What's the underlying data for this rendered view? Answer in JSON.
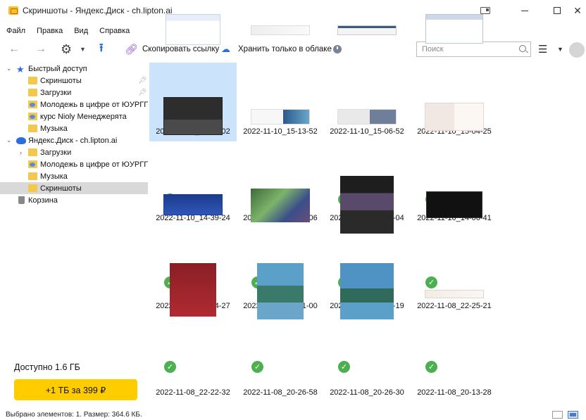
{
  "window": {
    "title": "Скриншоты - Яндекс.Диск - ch.lipton.ai"
  },
  "menu": [
    "Файл",
    "Правка",
    "Вид",
    "Справка"
  ],
  "toolbar": {
    "back_icon": "arrow-left-icon",
    "forward_icon": "arrow-right-icon",
    "copy_link_label": "Скопировать ссылку",
    "cloud_only_label": "Хранить только в облаке"
  },
  "search": {
    "placeholder": "Поиск",
    "value": ""
  },
  "sidebar": {
    "quick_access": {
      "label": "Быстрый доступ",
      "items": [
        "Скриншоты",
        "Загрузки",
        "Молодежь в цифре от ЮУРГГПУ",
        "курс Nioly Менеджерята",
        "Музыка"
      ]
    },
    "disk": {
      "label": "Яндекс.Диск - ch.lipton.ai",
      "items": [
        "Загрузки",
        "Молодежь в цифре от ЮУРГГПУ",
        "Музыка",
        "Скриншоты"
      ],
      "selected": "Скриншоты"
    },
    "trash_label": "Корзина",
    "storage_text": "Доступно 1.6 ГБ",
    "buy_button": "+1 ТБ за 399 ₽"
  },
  "files": [
    {
      "name": "2022-11-10_15-04-02",
      "selected": true
    },
    {
      "name": "2022-11-10_15-13-52",
      "selected": false
    },
    {
      "name": "2022-11-10_15-06-52",
      "selected": false
    },
    {
      "name": "2022-11-10_15-04-25",
      "selected": false
    },
    {
      "name": "2022-11-10_14-39-24",
      "selected": false
    },
    {
      "name": "2022-11-10_14-09-06",
      "selected": false
    },
    {
      "name": "2022-11-10_14-07-04",
      "selected": false
    },
    {
      "name": "2022-11-10_14-06-41",
      "selected": false
    },
    {
      "name": "2022-11-10_13-54-27",
      "selected": false
    },
    {
      "name": "2022-11-09_20-21-00",
      "selected": false
    },
    {
      "name": "2022-11-09_19-41-19",
      "selected": false
    },
    {
      "name": "2022-11-08_22-25-21",
      "selected": false
    },
    {
      "name": "2022-11-08_22-22-32",
      "selected": false
    },
    {
      "name": "2022-11-08_20-26-58",
      "selected": false
    },
    {
      "name": "2022-11-08_20-26-30",
      "selected": false
    },
    {
      "name": "2022-11-08_20-13-28",
      "selected": false
    }
  ],
  "status": {
    "text": "Выбрано элементов: 1. Размер: 364.6 КБ."
  },
  "colors": {
    "accent": "#2a6fdb",
    "buy_button": "#ffcc00",
    "selection": "#cce4fb",
    "check": "#4caf50"
  }
}
